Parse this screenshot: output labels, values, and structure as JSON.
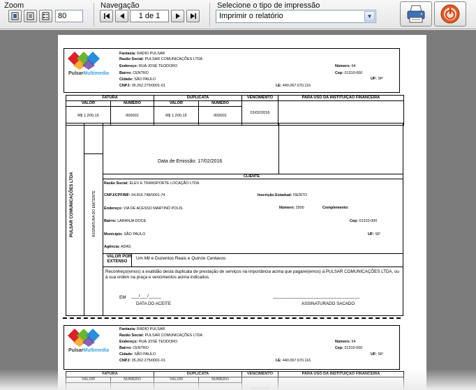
{
  "toolbar": {
    "zoom_label": "Zoom",
    "zoom_value": "80",
    "nav_label": "Navegação",
    "page_display": "1 de 1",
    "print_type_label": "Selecione o tipo de impressão",
    "print_type_value": "Imprimir o relatório",
    "icons": {
      "zoom_whole": "single-page-icon",
      "zoom_width": "page-width-icon",
      "zoom_custom": "custom-zoom-icon",
      "first": "first-page-icon",
      "prev": "previous-page-icon",
      "next": "next-page-icon",
      "last": "last-page-icon",
      "print": "printer-icon",
      "close": "power-close-icon"
    }
  },
  "logo": {
    "name_part1": "Pulsar",
    "name_part2": "Multimedia"
  },
  "company": {
    "fantasia_label": "Fantasia:",
    "fantasia": "RÁDIO PULSAR",
    "razao_label": "Razão Social:",
    "razao": "PULSAR COMUNICAÇÕES LTDA",
    "endereco_label": "Endereço:",
    "endereco": "RUA JOSÉ TEODORO",
    "numero_label": "Número:",
    "numero": "64",
    "bairro_label": "Bairro:",
    "bairro": "CENTRO",
    "cep_label": "Cep:",
    "cep": "01310-000",
    "uf_label": "UF:",
    "uf": "SP",
    "cidade_label": "Cidade:",
    "cidade": "SÃO PAULO",
    "cnpj_label": "CNPJ:",
    "cnpj": "05.262.275/0001-01",
    "ie_label": "I.E:",
    "ie": "440.067.670.116"
  },
  "table": {
    "fatura": "FATURA",
    "duplicata": "DUPLICATA",
    "vencimento": "VENCIMENTO",
    "instituicao": "PARA USO DA INSTITUIÇÃO FINANCEIRA",
    "valor": "VALOR",
    "numero": "NÚMERO",
    "fatura_valor": "R$ 1.200,15",
    "fatura_numero": "000001",
    "dup_valor": "R$ 1.200,15",
    "dup_numero": "000001",
    "vencimento_data": "01/02/2016"
  },
  "emissao": {
    "label": "Data de Emissão:",
    "value": "17/02/2016"
  },
  "cliente": {
    "heading": "CLIENTE",
    "razao_label": "Razão Social:",
    "razao": "ELEV E TRANSPORTE LOCAÇÃO LTDA",
    "cnpj_label": "CNPJ/CPF/MF:",
    "cnpj": "04.816.748/0001-74",
    "ie_label": "Inscrição Estadual:",
    "ie": "ISENTO",
    "endereco_label": "Endereço:",
    "endereco": "VIA DE ACESSO MARTINÓ POLIS",
    "numero_label": "Número:",
    "numero": "2500",
    "complemento_label": "Complemento:",
    "complemento": "",
    "bairro_label": "Bairro:",
    "bairro": "LARANJA DOCE",
    "cep_label": "Cep:",
    "cep": "01310-000",
    "municipio_label": "Município:",
    "municipio": "SÃO PAULO",
    "uf_label": "UF:",
    "uf": "SP",
    "agencia_label": "Agência:",
    "agencia": "ADAS"
  },
  "side": {
    "company_vertical": "PULSAR COMUNICAÇÕES LTDA",
    "emitente_vertical": "ASSINATURA DO EMITENTE"
  },
  "extenso": {
    "label1": "VALOR POR",
    "label2": "EXTENSO",
    "value": "Um Mil e Duzentos Reais e Quinze Centavos"
  },
  "statement": "Reconheço(emos) a exatidão desta duplicata de prestação de serviços na importância acima que pagarei(emos) à PULSAR COMUNICAÇÕES LTDA, ou à sua ordem na praça e vencimentos acima indicados.",
  "signature": {
    "em": "EM",
    "date_placeholder": "___/___/_____",
    "data_aceite": "DATA DO ACEITE",
    "sacado_line": "___________________________________",
    "assinatura_sacado": "ASSINATURADO SACADO"
  }
}
